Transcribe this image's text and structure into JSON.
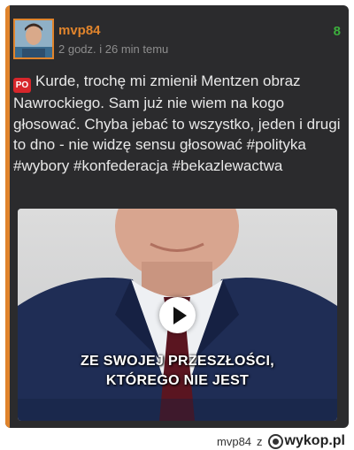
{
  "post": {
    "author": "mvp84",
    "timestamp": "2 godz. i 26 min temu",
    "votes": "8",
    "ad_badge": "PO",
    "text": "Kurde, trochę mi zmienił Mentzen obraz Nawrockiego. Sam już nie wiem na kogo głosować. Chyba jebać to wszystko, jeden i drugi to dno - nie widzę sensu głosować",
    "tags": [
      "#polityka",
      "#wybory",
      "#konfederacja",
      "#bekazlewactwa"
    ]
  },
  "video": {
    "caption_line1": "ZE SWOJEJ PRZESZŁOŚCI,",
    "caption_line2": "KTÓREGO NIE JEST",
    "play_icon": "play-icon"
  },
  "footer": {
    "author": "mvp84",
    "separator": "z",
    "site": "wykop.pl"
  },
  "colors": {
    "accent": "#e0842c",
    "card_bg": "#2b2b2d",
    "votes": "#3cae3c",
    "badge": "#d7262b"
  }
}
